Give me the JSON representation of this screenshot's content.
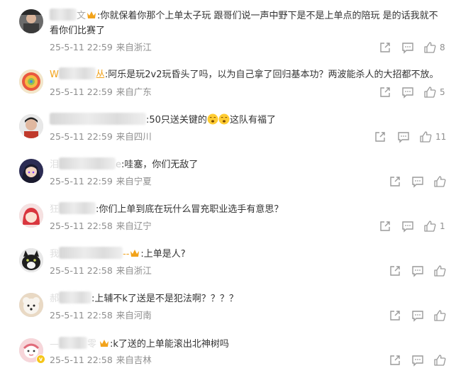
{
  "comments": [
    {
      "name_tail": "文",
      "text": ":你就保着你那个上单太子玩 跟哥们说一声中野下是不是上单点的陪玩 是的话我就不",
      "text2": "看你们比赛了",
      "date": "25-5-11 22:59",
      "loc": "来自浙江",
      "likes": "8"
    },
    {
      "name_head": "W",
      "name_tail": "丛",
      "text": ":阿乐是玩2v2玩昏头了吗，以为自己拿了回归基本功？两波能杀人的大招都不放。",
      "date": "25-5-11 22:59",
      "loc": "来自广东",
      "likes": "5"
    },
    {
      "text": ":50只送关键的",
      "text_after": "这队有福了",
      "date": "25-5-11 22:59",
      "loc": "来自四川",
      "likes": "11"
    },
    {
      "name_head": "泪",
      "name_tail": "e",
      "text": ":哇塞，你们无敌了",
      "date": "25-5-11 22:59",
      "loc": "来自宁夏",
      "likes": ""
    },
    {
      "name_head": "狂",
      "text": ":你们上单到底在玩什么冒充职业选手有意思？",
      "date": "25-5-11 22:58",
      "loc": "来自辽宁",
      "likes": "1"
    },
    {
      "name_head": "我",
      "name_tail": "--",
      "text": ":上单是人?",
      "date": "25-5-11 22:58",
      "loc": "来自浙江",
      "likes": ""
    },
    {
      "name_head": "郝",
      "text": ":上辅不k了送是不是犯法啊？？？？",
      "date": "25-5-11 22:58",
      "loc": "来自河南",
      "likes": ""
    },
    {
      "name_head": "—",
      "name_tail": "零",
      "text": ":k了送的上单能滚出北神树吗",
      "date": "25-5-11 22:58",
      "loc": "来自吉林",
      "likes": ""
    }
  ],
  "colors": {
    "text": "#333333",
    "meta": "#8e8e8e",
    "icon": "#9a9a9a",
    "crown": "#f2a31b"
  },
  "icons": [
    "share-icon",
    "comment-icon",
    "like-icon",
    "crown-badge-icon",
    "face-emoji-icon"
  ]
}
